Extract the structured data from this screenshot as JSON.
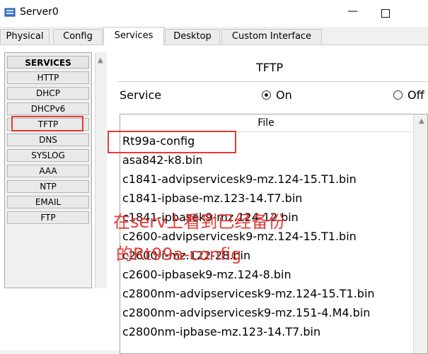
{
  "window": {
    "title": "Server0",
    "minimize_glyph": "—",
    "close_glyph": "✕"
  },
  "tabs": [
    {
      "label": "Physical"
    },
    {
      "label": "Config"
    },
    {
      "label": "Services",
      "active": true
    },
    {
      "label": "Desktop"
    },
    {
      "label": "Custom Interface"
    }
  ],
  "services": {
    "header": "SERVICES",
    "items": [
      {
        "label": "HTTP"
      },
      {
        "label": "DHCP"
      },
      {
        "label": "DHCPv6"
      },
      {
        "label": "TFTP",
        "selected": true
      },
      {
        "label": "DNS"
      },
      {
        "label": "SYSLOG"
      },
      {
        "label": "AAA"
      },
      {
        "label": "NTP"
      },
      {
        "label": "EMAIL"
      },
      {
        "label": "FTP"
      }
    ]
  },
  "tftp": {
    "title": "TFTP",
    "service_label": "Service",
    "on_label": "On",
    "off_label": "Off",
    "service_state": "On"
  },
  "file_table": {
    "header": "File",
    "files": [
      "Rt99a-config",
      "asa842-k8.bin",
      "c1841-advipservicesk9-mz.124-15.T1.bin",
      "c1841-ipbase-mz.123-14.T7.bin",
      "c1841-ipbasek9-mz.124-12.bin",
      "c2600-advipservicesk9-mz.124-15.T1.bin",
      "c2600-i-mz.122-28.bin",
      "c2600-ipbasek9-mz.124-8.bin",
      "c2800nm-advipservicesk9-mz.124-15.T1.bin",
      "c2800nm-advipservicesk9-mz.151-4.M4.bin",
      "c2800nm-ipbase-mz.123-14.T7.bin"
    ]
  },
  "annotation": {
    "line1": "在serv上看到已经备份",
    "line2": "的Rt99a-config",
    "color": "#e53935"
  },
  "icons": {
    "app": "server-app-icon",
    "scroll_up": "▲"
  }
}
